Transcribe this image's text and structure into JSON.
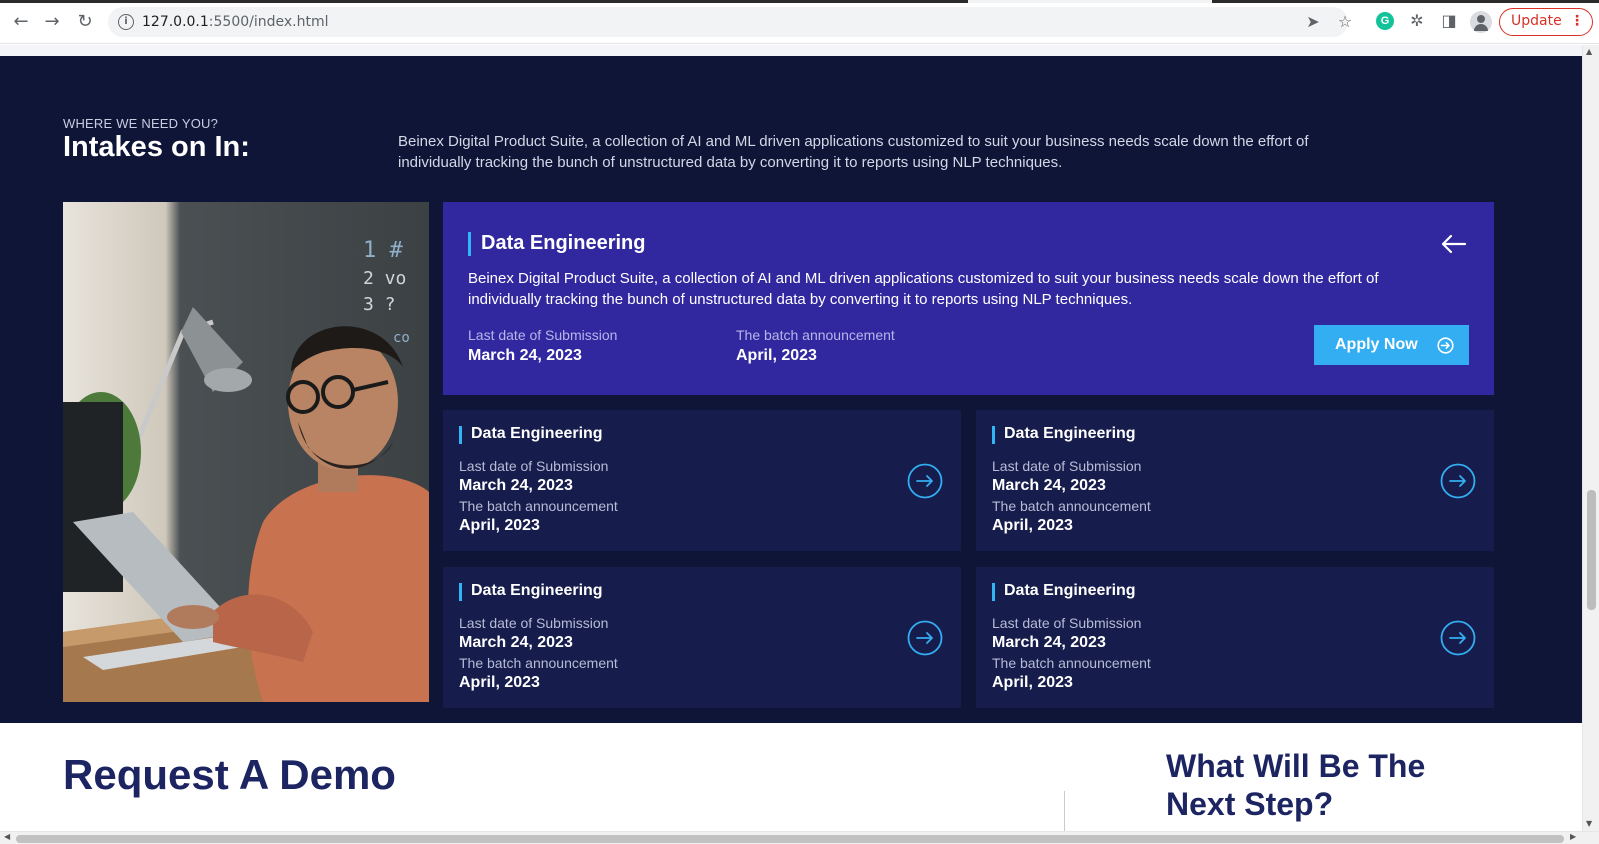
{
  "browser": {
    "url_host": "127.0.0.1",
    "url_rest": ":5500/index.html",
    "update_label": "Update",
    "update_menu_glyph": "⋮",
    "grammarly_glyph": "G"
  },
  "intakes": {
    "eyebrow": "WHERE WE NEED YOU?",
    "title": "Intakes on In:",
    "description": "Beinex Digital Product Suite, a collection of AI and ML driven applications customized to suit your business needs scale down the effort of individually tracking the bunch of unstructured data by converting it to reports using NLP techniques.",
    "featured": {
      "title": "Data Engineering",
      "description": "Beinex Digital Product Suite, a collection of AI and ML driven applications customized to suit your business needs scale down the effort of individually tracking the bunch of unstructured data by converting it to reports using NLP techniques.",
      "submission_label": "Last date of Submission",
      "submission_value": "March 24, 2023",
      "announcement_label": "The batch announcement",
      "announcement_value": "April, 2023",
      "apply_label": "Apply Now"
    },
    "cards": [
      {
        "title": "Data Engineering",
        "submission_label": "Last date of Submission",
        "submission_value": "March 24, 2023",
        "announcement_label": "The batch announcement",
        "announcement_value": "April, 2023"
      },
      {
        "title": "Data Engineering",
        "submission_label": "Last date of Submission",
        "submission_value": "March 24, 2023",
        "announcement_label": "The batch announcement",
        "announcement_value": "April, 2023"
      },
      {
        "title": "Data Engineering",
        "submission_label": "Last date of Submission",
        "submission_value": "March 24, 2023",
        "announcement_label": "The batch announcement",
        "announcement_value": "April, 2023"
      },
      {
        "title": "Data Engineering",
        "submission_label": "Last date of Submission",
        "submission_value": "March 24, 2023",
        "announcement_label": "The batch announcement",
        "announcement_value": "April, 2023"
      }
    ]
  },
  "demo": {
    "title": "Request A Demo",
    "next_step_title": "What Will Be The Next Step?"
  },
  "colors": {
    "section_bg": "#0e1537",
    "featured_bg": "#3128a0",
    "card_bg": "#161c4b",
    "accent": "#33aef2",
    "heading_dark": "#1c2561"
  },
  "icons": {
    "back": "arrow-left-icon",
    "forward": "arrow-right-icon",
    "reload": "reload-icon",
    "site_info": "info-icon",
    "share": "send-icon",
    "bookmark": "star-icon",
    "extensions": "puzzle-icon",
    "sidebar": "side-panel-icon",
    "profile": "profile-icon",
    "card_go": "circle-arrow-right-icon",
    "featured_back": "arrow-left-icon",
    "apply": "circle-arrow-right-icon"
  }
}
